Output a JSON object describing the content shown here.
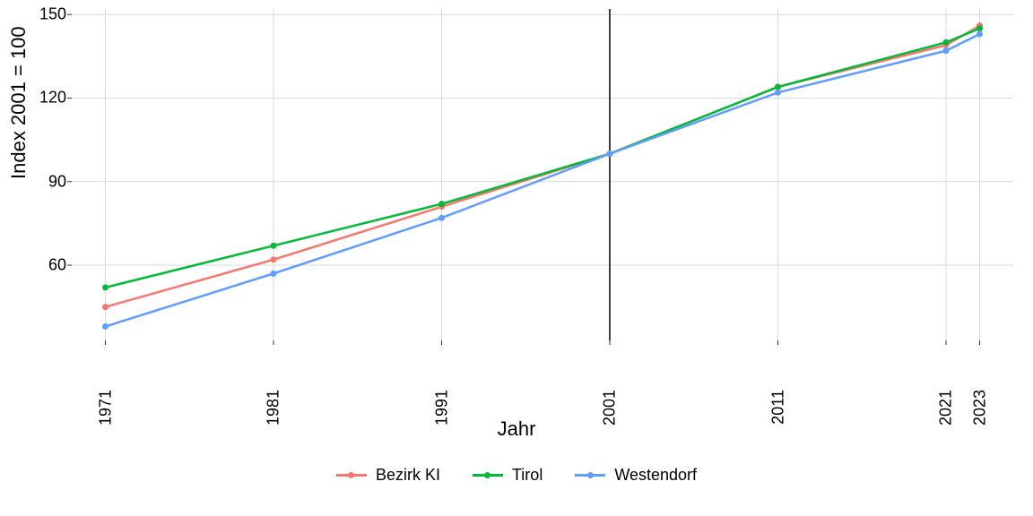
{
  "chart_data": {
    "type": "line",
    "xlabel": "Jahr",
    "ylabel": "Index 2001 = 100",
    "x": [
      1971,
      1981,
      1991,
      2001,
      2011,
      2021,
      2023
    ],
    "x_tick_labels": [
      "1971",
      "1981",
      "1991",
      "2001",
      "2011",
      "2021",
      "2023"
    ],
    "y_ticks": [
      60,
      90,
      120,
      150
    ],
    "y_tick_labels": [
      "60",
      "90",
      "120",
      "150"
    ],
    "xlim": [
      1969,
      2025
    ],
    "ylim": [
      33,
      152
    ],
    "reference_vline_x": 2001,
    "grid": true,
    "legend_position": "bottom",
    "series": [
      {
        "name": "Bezirk KI",
        "color": "#F8766D",
        "values": [
          45,
          62,
          81,
          100,
          124,
          139,
          146
        ]
      },
      {
        "name": "Tirol",
        "color": "#00BA38",
        "values": [
          52,
          67,
          82,
          100,
          124,
          140,
          145
        ]
      },
      {
        "name": "Westendorf",
        "color": "#619CFF",
        "values": [
          38,
          57,
          77,
          100,
          122,
          137,
          143
        ]
      }
    ]
  }
}
